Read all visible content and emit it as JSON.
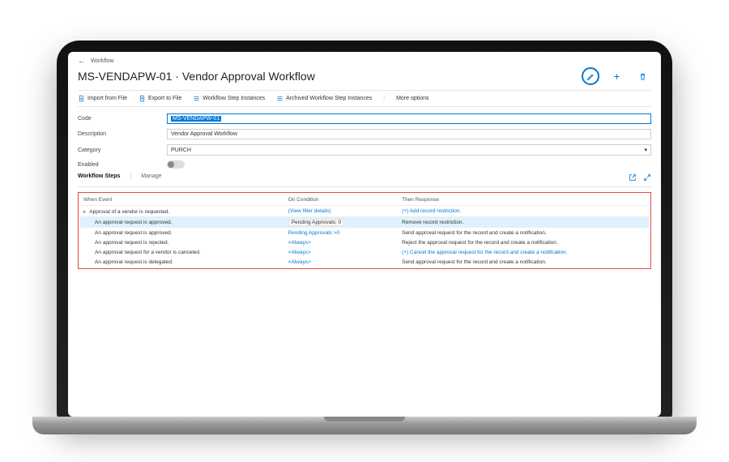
{
  "breadcrumb": "Workflow",
  "page_title": "MS-VENDAPW-01 · Vendor Approval Workflow",
  "toolbar": {
    "import": "Import from File",
    "export": "Export to File",
    "instances": "Workflow Step Instances",
    "archived_instances": "Archived Workflow Step Instances",
    "more": "More options"
  },
  "form": {
    "code_label": "Code",
    "code_value": "MS-VENDAPW-01",
    "description_label": "Description",
    "description_value": "Vendor Approval Workflow",
    "category_label": "Category",
    "category_value": "PURCH",
    "enabled_label": "Enabled"
  },
  "tabs": {
    "steps": "Workflow Steps",
    "manage": "Manage"
  },
  "table": {
    "headers": {
      "event": "When Event",
      "condition": "On Condition",
      "response": "Then Response"
    },
    "rows": [
      {
        "event": "Approval of a vendor is requested.",
        "condition": "(View filter details)",
        "response": "(+) Add record restriction.",
        "expandable": true,
        "cond_link": true,
        "resp_link": true
      },
      {
        "event": "An approval request is approved.",
        "condition": "Pending Approvals: 0",
        "response": "Remove record restriction.",
        "indent": true,
        "selected": true,
        "cond_pill": true
      },
      {
        "event": "An approval request is approved.",
        "condition": "Pending Approvals >0",
        "response": "Send approval request for the record and create a notification.",
        "indent": true,
        "cond_link": true
      },
      {
        "event": "An approval request is rejected.",
        "condition": "<Always>",
        "response": "Reject the approval request for the record and create a notification.",
        "indent": true,
        "cond_link": true
      },
      {
        "event": "An approval request for a vendor is canceled.",
        "condition": "<Always>",
        "response": "(+) Cancel the approval request for the record and create a notification.",
        "indent": true,
        "cond_link": true,
        "resp_link": true
      },
      {
        "event": "An approval request is delegated.",
        "condition": "<Always>",
        "response": "Send approval request for the record and create a notification.",
        "indent": true,
        "cond_link": true
      }
    ]
  }
}
